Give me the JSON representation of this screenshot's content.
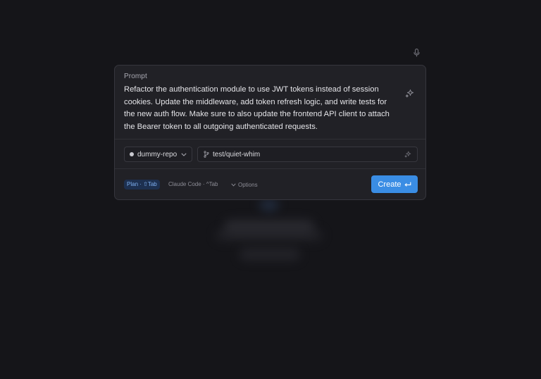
{
  "prompt": {
    "label": "Prompt",
    "text": "Refactor the authentication module to use JWT tokens instead of session cookies. Update the middleware, add token refresh logic, and write tests for the new auth flow. Make sure to also update the frontend API client to attach the Bearer token to all outgoing authenticated requests."
  },
  "repo": {
    "name": "dummy-repo"
  },
  "branch": {
    "name": "test/quiet-whim"
  },
  "footer": {
    "plan_badge": "Plan · ⇧Tab",
    "claude_code": "Claude Code · ^Tab",
    "options_label": "Options"
  },
  "create_label": "Create",
  "icons": [
    "microphone-icon",
    "sparkle-icon",
    "chevron-down-icon",
    "git-branch-icon",
    "return-key-icon"
  ],
  "colors": {
    "background": "#151519",
    "card": "#212126",
    "accent": "#3a8de4",
    "plan_badge_bg": "#1d3050"
  }
}
